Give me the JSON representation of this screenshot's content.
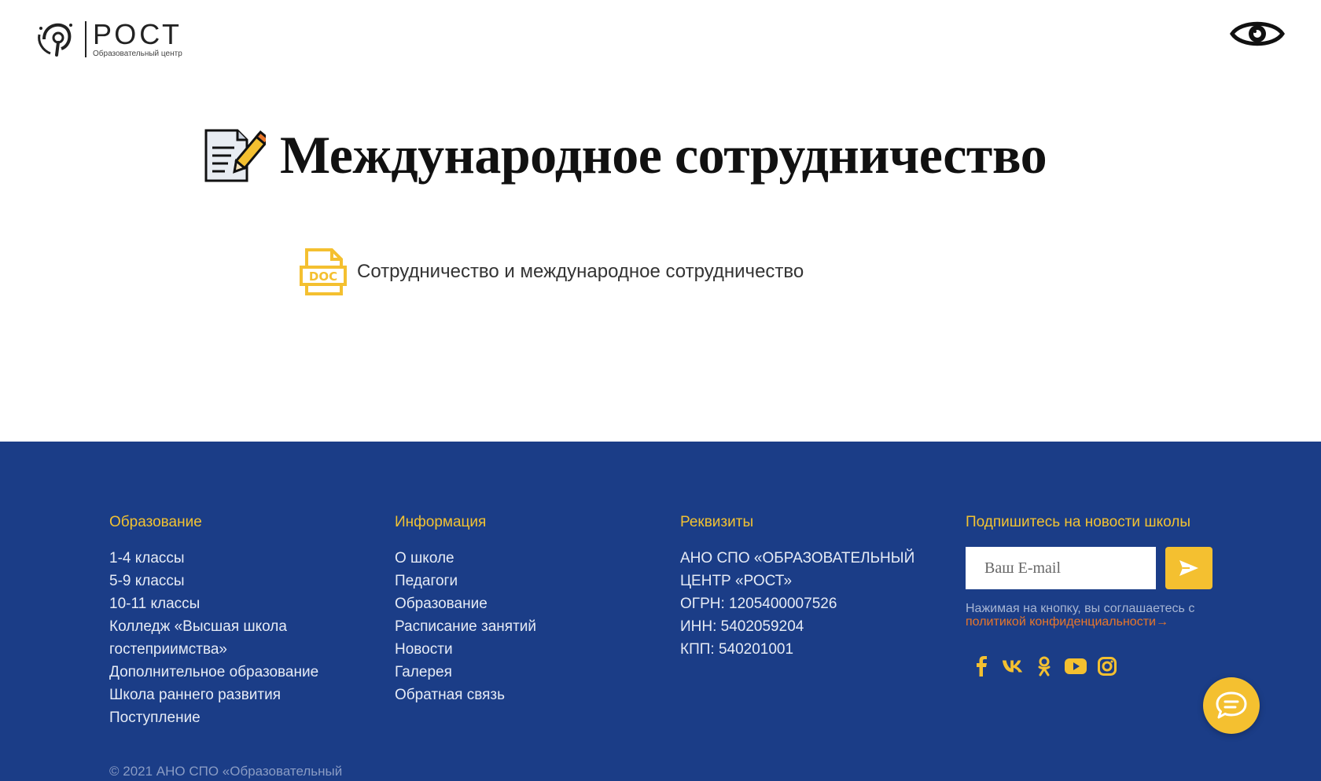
{
  "header": {
    "logo_title": "РОСТ",
    "logo_subtitle": "Образовательный центр",
    "accessibility_icon": "eye-icon"
  },
  "main": {
    "title": "Международное сотрудничество",
    "title_icon": "document-edit-icon",
    "documents": [
      {
        "icon": "doc-file-icon",
        "label": "Сотрудничество и международное сотрудничество"
      }
    ]
  },
  "footer": {
    "columns": [
      {
        "heading": "Образование",
        "items": [
          "1-4 классы",
          "5-9 классы",
          "10-11 классы",
          "Колледж «Высшая школа",
          "гостеприимства»",
          "Дополнительное образование",
          "Школа раннего развития",
          "Поступление"
        ]
      },
      {
        "heading": "Информация",
        "items": [
          "О школе",
          "Педагоги",
          "Образование",
          "Расписание занятий",
          "Новости",
          "Галерея",
          "Обратная связь"
        ]
      },
      {
        "heading": "Реквизиты",
        "items": [
          "АНО СПО «ОБРАЗОВАТЕЛЬНЫЙ",
          "ЦЕНТР «РОСТ»",
          "ОГРН: 1205400007526",
          "ИНН: 5402059204",
          "КПП: 540201001"
        ]
      }
    ],
    "subscribe": {
      "heading": "Подпишитесь на новости школы",
      "email_placeholder": "Ваш E-mail",
      "consent_text": "Нажимая на кнопку, вы соглашаетесь с ",
      "consent_link": "политикой конфиденциальности→"
    },
    "socials": [
      "facebook-icon",
      "vk-icon",
      "odnoklassniki-icon",
      "youtube-icon",
      "instagram-icon"
    ],
    "copyright": "© 2021 АНО СПО «Образовательный"
  },
  "colors": {
    "footer_bg": "#1b3d87",
    "accent_yellow": "#f4c030",
    "heading_yellow": "#f2c232",
    "link_orange": "#e8762a"
  }
}
